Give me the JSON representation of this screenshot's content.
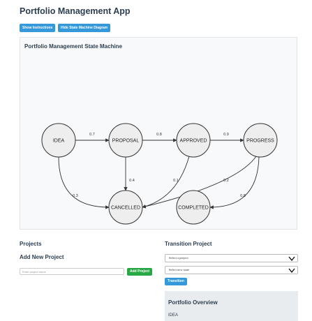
{
  "app": {
    "title": "Portfolio Management App"
  },
  "toolbar": {
    "show_instructions": "Show Instructions",
    "hide_diagram": "Hide State Machine Diagram"
  },
  "diagram": {
    "title": "Portfolio Management State Machine",
    "nodes": [
      {
        "id": "IDEA",
        "label": "IDEA"
      },
      {
        "id": "PROPOSAL",
        "label": "PROPOSAL"
      },
      {
        "id": "APPROVED",
        "label": "APPROVED"
      },
      {
        "id": "IN_PROGRESS",
        "label": "PROGRESS"
      },
      {
        "id": "CANCELLED",
        "label": "CANCELLED"
      },
      {
        "id": "COMPLETED",
        "label": "COMPLETED"
      }
    ],
    "edges": [
      {
        "from": "IDEA",
        "to": "PROPOSAL",
        "label": "0.7"
      },
      {
        "from": "PROPOSAL",
        "to": "APPROVED",
        "label": "0.8"
      },
      {
        "from": "APPROVED",
        "to": "IN_PROGRESS",
        "label": "0.9"
      },
      {
        "from": "PROPOSAL",
        "to": "CANCELLED",
        "label": "0.4"
      },
      {
        "from": "IDEA",
        "to": "CANCELLED",
        "label": "0.3"
      },
      {
        "from": "APPROVED",
        "to": "CANCELLED",
        "label": "0.1"
      },
      {
        "from": "IN_PROGRESS",
        "to": "CANCELLED",
        "label": "0.2"
      },
      {
        "from": "IN_PROGRESS",
        "to": "COMPLETED",
        "label": "0.8"
      }
    ]
  },
  "projects": {
    "heading": "Projects",
    "add_heading": "Add New Project",
    "input_placeholder": "Enter project name",
    "add_button": "Add Project"
  },
  "transition": {
    "heading": "Transition Project",
    "select_project": "Select a project",
    "select_state": "Select new state",
    "button": "Transition"
  },
  "overview": {
    "title": "Portfolio Overview",
    "items": [
      "IDEA"
    ]
  }
}
